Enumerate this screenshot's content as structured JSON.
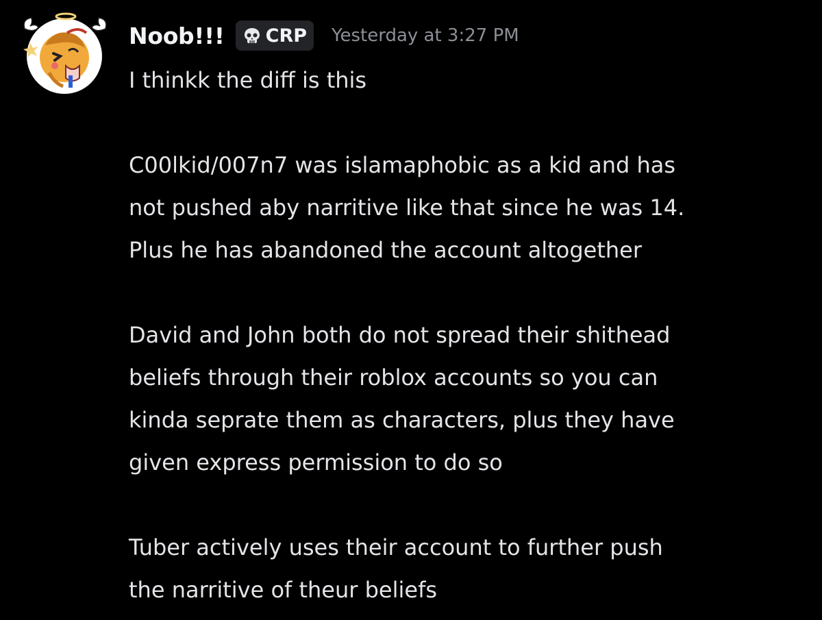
{
  "message": {
    "author": {
      "username": "Noob!!!",
      "tag_icon": "skull-icon",
      "tag_label": "CRP",
      "avatar": "avatar-image"
    },
    "timestamp": "Yesterday at 3:27 PM",
    "paragraphs": [
      {
        "lines": [
          "I thinkk the diff is this"
        ]
      },
      {
        "lines": [
          "C00lkid/007n7 was islamaphobic as a kid and has",
          "not pushed aby narritive like that since he was 14.",
          "Plus he has abandoned the account altogether"
        ]
      },
      {
        "lines": [
          "David and John both do not spread their shithead",
          "beliefs through their roblox accounts so you can",
          "kinda seprate them as characters, plus they have",
          "given express permission to do so"
        ]
      },
      {
        "lines": [
          "Tuber actively uses their account to further push",
          "the narritive of theur beliefs"
        ]
      }
    ]
  },
  "colors": {
    "background": "#000000",
    "username": "#f2f3f5",
    "message_text": "#e4e5e8",
    "timestamp": "#8c8f96",
    "tag_background": "#232428",
    "avatar_accent": "#f2a93b"
  }
}
